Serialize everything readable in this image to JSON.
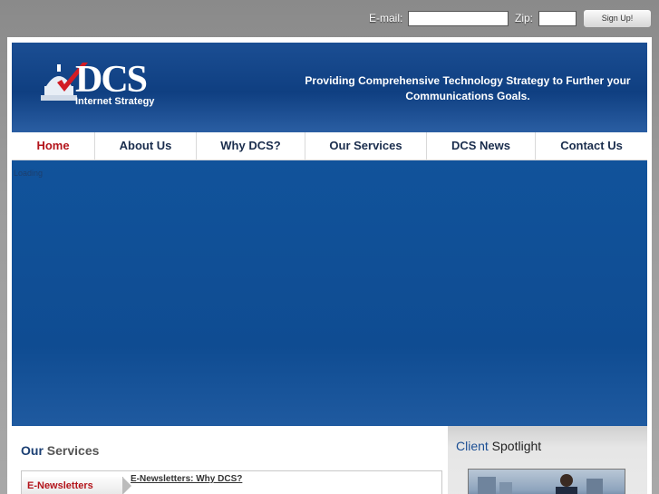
{
  "signup": {
    "email_label": "E-mail:",
    "email_value": "",
    "zip_label": "Zip:",
    "zip_value": "",
    "button_label": "Sign Up!"
  },
  "header": {
    "logo_text": "DCS",
    "logo_subtitle": "Internet Strategy",
    "tagline_line1": "Providing Comprehensive Technology Strategy to Further your",
    "tagline_line2": "Communications Goals."
  },
  "nav": {
    "items": [
      {
        "label": "Home",
        "active": true
      },
      {
        "label": "About Us",
        "active": false
      },
      {
        "label": "Why DCS?",
        "active": false
      },
      {
        "label": "Our Services",
        "active": false
      },
      {
        "label": "DCS News",
        "active": false
      },
      {
        "label": "Contact Us",
        "active": false
      }
    ]
  },
  "banner": {
    "loading_text": "Loading"
  },
  "services": {
    "title_part1": "Our",
    "title_part2": " Services",
    "tab_label": "E-Newsletters",
    "link_text": "E-Newsletters: Why DCS?"
  },
  "sidebar": {
    "title_part1": "Client",
    "title_part2": " Spotlight"
  },
  "colors": {
    "brand_blue": "#1b4e93",
    "active_red": "#b3141b"
  }
}
